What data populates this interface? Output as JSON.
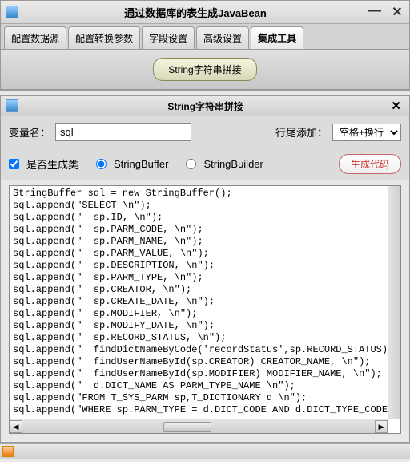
{
  "mainWindow": {
    "title": "通过数据库的表生成JavaBean"
  },
  "tabs": [
    "配置数据源",
    "配置转换参数",
    "字段设置",
    "高级设置",
    "集成工具"
  ],
  "activeTab": 4,
  "mainButton": "String字符串拼接",
  "subWindow": {
    "title": "String字符串拼接"
  },
  "form": {
    "varLabel": "变量名：",
    "varValue": "sql",
    "lineEndLabel": "行尾添加：",
    "lineEndValue": "空格+换行",
    "genClassLabel": "是否生成类",
    "genClassChecked": true,
    "bufferLabel": "StringBuffer",
    "bufferSelected": true,
    "builderLabel": "StringBuilder",
    "builderSelected": false,
    "genBtn": "生成代码"
  },
  "code": "StringBuffer sql = new StringBuffer();\nsql.append(\"SELECT \\n\");\nsql.append(\"  sp.ID, \\n\");\nsql.append(\"  sp.PARM_CODE, \\n\");\nsql.append(\"  sp.PARM_NAME, \\n\");\nsql.append(\"  sp.PARM_VALUE, \\n\");\nsql.append(\"  sp.DESCRIPTION, \\n\");\nsql.append(\"  sp.PARM_TYPE, \\n\");\nsql.append(\"  sp.CREATOR, \\n\");\nsql.append(\"  sp.CREATE_DATE, \\n\");\nsql.append(\"  sp.MODIFIER, \\n\");\nsql.append(\"  sp.MODIFY_DATE, \\n\");\nsql.append(\"  sp.RECORD_STATUS, \\n\");\nsql.append(\"  findDictNameByCode('recordStatus',sp.RECORD_STATUS) RECORD_STATU\nsql.append(\"  findUserNameById(sp.CREATOR) CREATOR_NAME, \\n\");\nsql.append(\"  findUserNameById(sp.MODIFIER) MODIFIER_NAME, \\n\");\nsql.append(\"  d.DICT_NAME AS PARM_TYPE_NAME \\n\");\nsql.append(\"FROM T_SYS_PARM sp,T_DICTIONARY d \\n\");\nsql.append(\"WHERE sp.PARM_TYPE = d.DICT_CODE AND d.DICT_TYPE_CODE = 'parameter"
}
